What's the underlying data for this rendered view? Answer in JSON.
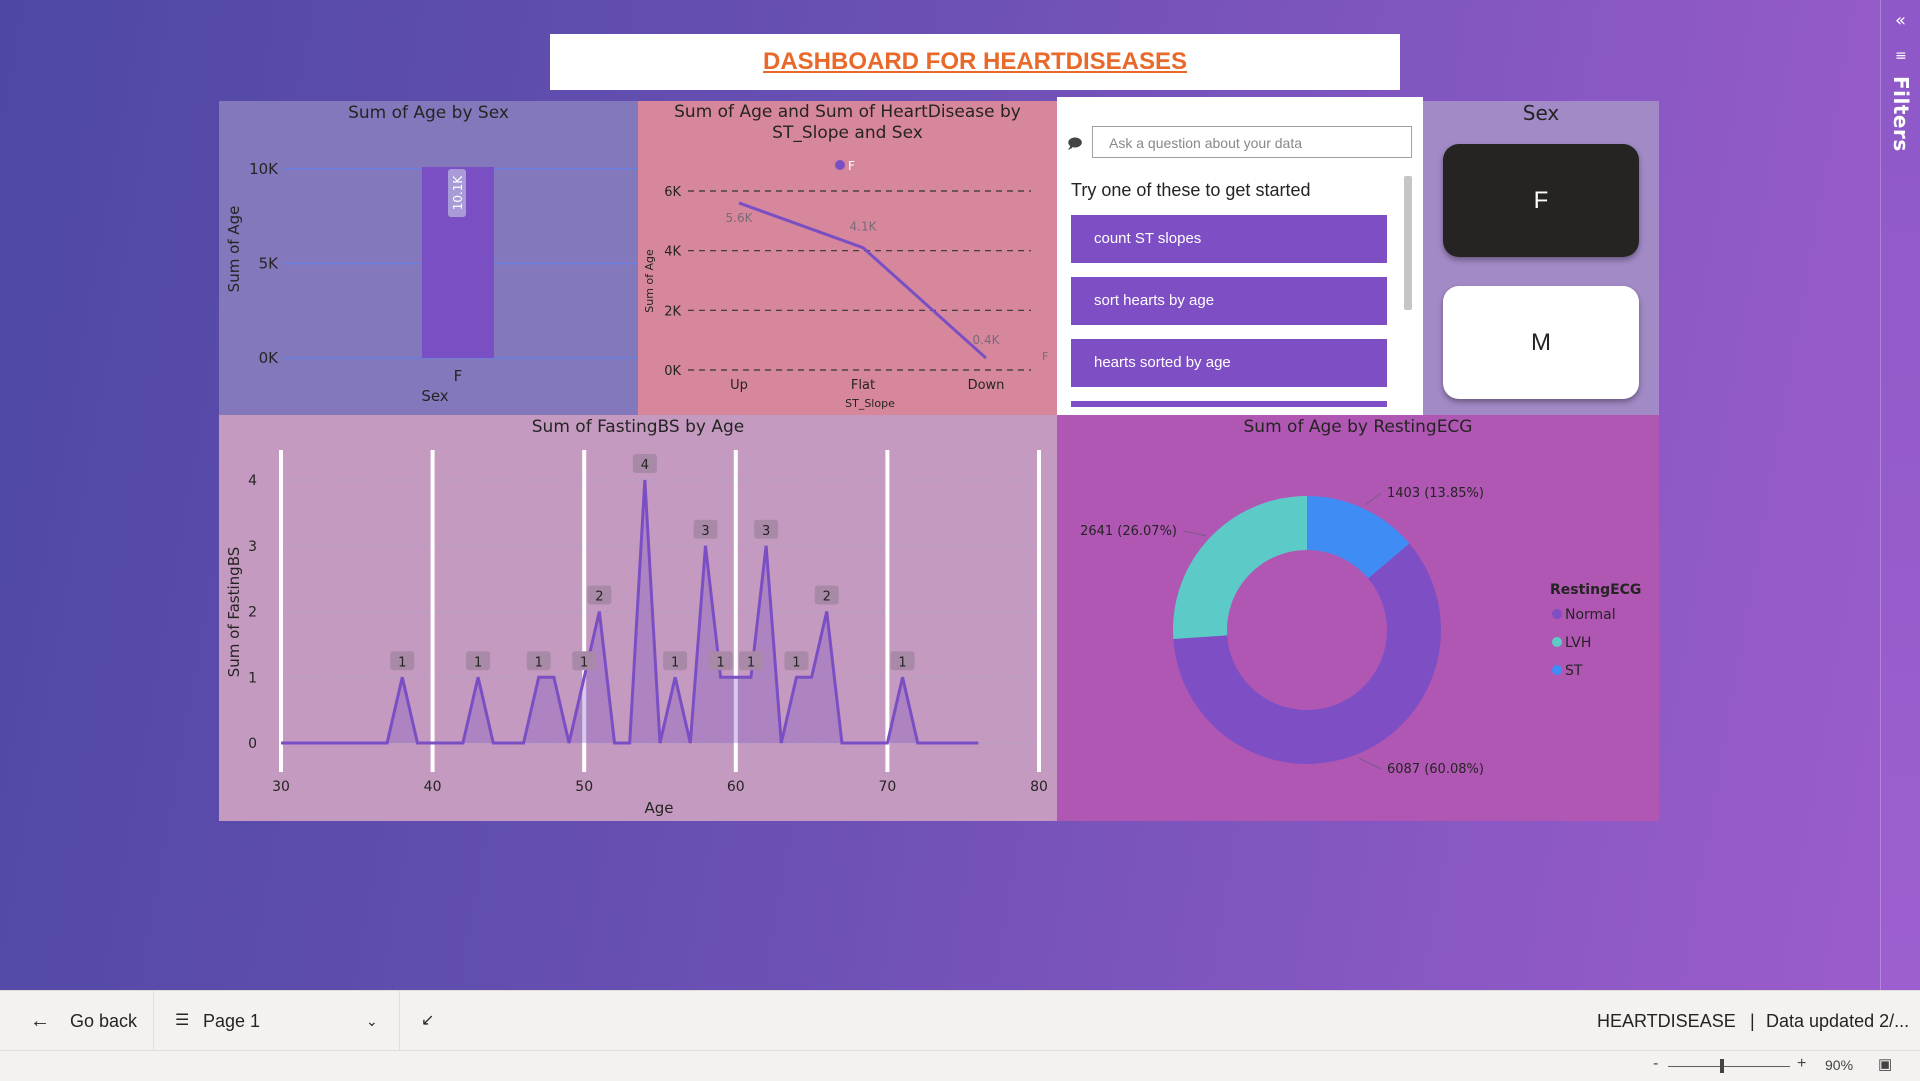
{
  "report": {
    "title": "DASHBOARD FOR HEARTDISEASES"
  },
  "filters_pane": {
    "label": "Filters"
  },
  "age_by_sex": {
    "title": "Sum of Age by Sex",
    "chart_data": {
      "type": "bar",
      "title": "Sum of Age by Sex",
      "categories": [
        "F"
      ],
      "values": [
        10100
      ],
      "data_labels": [
        "10.1K"
      ],
      "xlabel": "Sex",
      "ylabel": "Sum of Age",
      "yticks": [
        "0K",
        "5K",
        "10K"
      ],
      "ylim": [
        0,
        10100
      ],
      "color": "#7a4fc4"
    }
  },
  "slope_chart": {
    "title": "Sum of Age and Sum of HeartDisease by ST_Slope and Sex",
    "title_line1": "Sum of Age and Sum of HeartDisease by",
    "title_line2": "ST_Slope and Sex",
    "legend": "F",
    "right_marker": "F",
    "chart_data": {
      "type": "line",
      "title": "Sum of Age and Sum of HeartDisease by ST_Slope and Sex",
      "categories": [
        "Up",
        "Flat",
        "Down"
      ],
      "series": [
        {
          "name": "F",
          "values": [
            5600,
            4100,
            400
          ]
        }
      ],
      "data_labels": [
        "5.6K",
        "4.1K",
        "0.4K"
      ],
      "xlabel": "ST_Slope",
      "ylabel": "Sum of Age",
      "yticks": [
        "0K",
        "2K",
        "4K",
        "6K"
      ],
      "ylim": [
        0,
        6000
      ],
      "grid": true,
      "color": "#7a4fc4"
    }
  },
  "qa": {
    "placeholder": "Ask a question about your data",
    "prompt": "Try one of these to get started",
    "suggestions": [
      "count ST slopes",
      "sort hearts by age",
      "hearts sorted by age"
    ]
  },
  "sex_slicer": {
    "title": "Sex",
    "options": [
      "F",
      "M"
    ],
    "selected": "F"
  },
  "fasting_chart": {
    "title": "Sum of FastingBS by Age",
    "chart_data": {
      "type": "area",
      "title": "Sum of FastingBS by Age",
      "xlabel": "Age",
      "ylabel": "Sum of FastingBS",
      "xlim": [
        30,
        80
      ],
      "ylim": [
        0,
        4
      ],
      "xticks": [
        "30",
        "40",
        "50",
        "60",
        "70",
        "80"
      ],
      "yticks": [
        "0",
        "1",
        "2",
        "3",
        "4"
      ],
      "x": [
        30,
        31,
        32,
        33,
        34,
        35,
        36,
        37,
        38,
        39,
        40,
        41,
        42,
        43,
        44,
        45,
        46,
        47,
        48,
        49,
        50,
        51,
        52,
        53,
        54,
        55,
        56,
        57,
        58,
        59,
        60,
        61,
        62,
        63,
        64,
        65,
        66,
        67,
        68,
        69,
        70,
        71,
        72,
        73,
        74,
        75,
        76
      ],
      "y": [
        0,
        0,
        0,
        0,
        0,
        0,
        0,
        0,
        1,
        0,
        0,
        0,
        0,
        1,
        0,
        0,
        0,
        1,
        1,
        0,
        1,
        2,
        0,
        0,
        4,
        0,
        1,
        0,
        3,
        1,
        1,
        1,
        3,
        0,
        1,
        1,
        2,
        0,
        0,
        0,
        0,
        1,
        0,
        0,
        0,
        0,
        0
      ],
      "data_labels": [
        {
          "x": 38,
          "label": "1"
        },
        {
          "x": 43,
          "label": "1"
        },
        {
          "x": 47,
          "label": "1"
        },
        {
          "x": 50,
          "label": "1"
        },
        {
          "x": 51,
          "label": "2"
        },
        {
          "x": 54,
          "label": "4"
        },
        {
          "x": 56,
          "label": "1"
        },
        {
          "x": 58,
          "label": "3"
        },
        {
          "x": 59,
          "label": "1"
        },
        {
          "x": 61,
          "label": "1"
        },
        {
          "x": 62,
          "label": "3"
        },
        {
          "x": 64,
          "label": "1"
        },
        {
          "x": 66,
          "label": "2"
        },
        {
          "x": 71,
          "label": "1"
        }
      ],
      "grid": true,
      "color": "#7a4fc4"
    }
  },
  "ecg_chart": {
    "title": "Sum of Age by RestingECG",
    "chart_data": {
      "type": "pie",
      "title": "Sum of Age by RestingECG",
      "legend_title": "RestingECG",
      "labels": [
        "Normal",
        "LVH",
        "ST"
      ],
      "values": [
        6087,
        2641,
        1403
      ],
      "data_labels": [
        "6087 (60.08%)",
        "2641 (26.07%)",
        "1403 (13.85%)"
      ],
      "colors": [
        "#7e4ec4",
        "#5ccbc7",
        "#3f8cf5"
      ],
      "legend_position": "right"
    }
  },
  "bottom_bar": {
    "go_back": "Go back",
    "page": "Page 1",
    "dataset": "HEARTDISEASE",
    "updated": "Data updated 2/..."
  },
  "status_bar": {
    "zoom": "90%"
  }
}
